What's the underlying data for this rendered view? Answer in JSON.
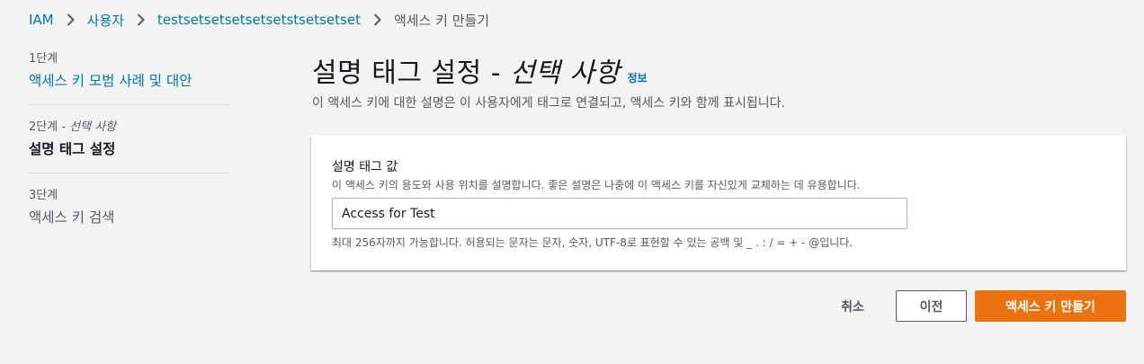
{
  "breadcrumb": {
    "items": [
      "IAM",
      "사용자",
      "testsetsetsetsetsetstsetsetset",
      "액세스 키 만들기"
    ]
  },
  "steps": [
    {
      "num": "1단계",
      "num_suffix": "",
      "title": "액세스 키 모범 사례 및 대안"
    },
    {
      "num": "2단계 - ",
      "num_suffix": "선택 사항",
      "title": "설명 태그 설정"
    },
    {
      "num": "3단계",
      "num_suffix": "",
      "title": "액세스 키 검색"
    }
  ],
  "page": {
    "title_main": "설명 태그 설정 - ",
    "title_optional": "선택 사항",
    "info_link": "정보",
    "description": "이 액세스 키에 대한 설명은 이 사용자에게 태그로 연결되고, 액세스 키와 함께 표시됩니다."
  },
  "field": {
    "label": "설명 태그 값",
    "description": "이 액세스 키의 용도와 사용 위치를 설명합니다. 좋은 설명은 나중에 이 액세스 키를 자신있게 교체하는 데 유용합니다.",
    "value": "Access for Test",
    "constraint": "최대 256자까지 가능합니다. 허용되는 문자는 문자, 숫자, UTF-8로 표현할 수 있는 공백 및 _ . : / = + - @입니다."
  },
  "actions": {
    "cancel": "취소",
    "previous": "이전",
    "create": "액세스 키 만들기"
  },
  "colors": {
    "link": "#0073bb",
    "primary": "#ec7211",
    "background": "#f2f3f3"
  },
  "icons": {
    "separator": "chevron-right-icon"
  }
}
